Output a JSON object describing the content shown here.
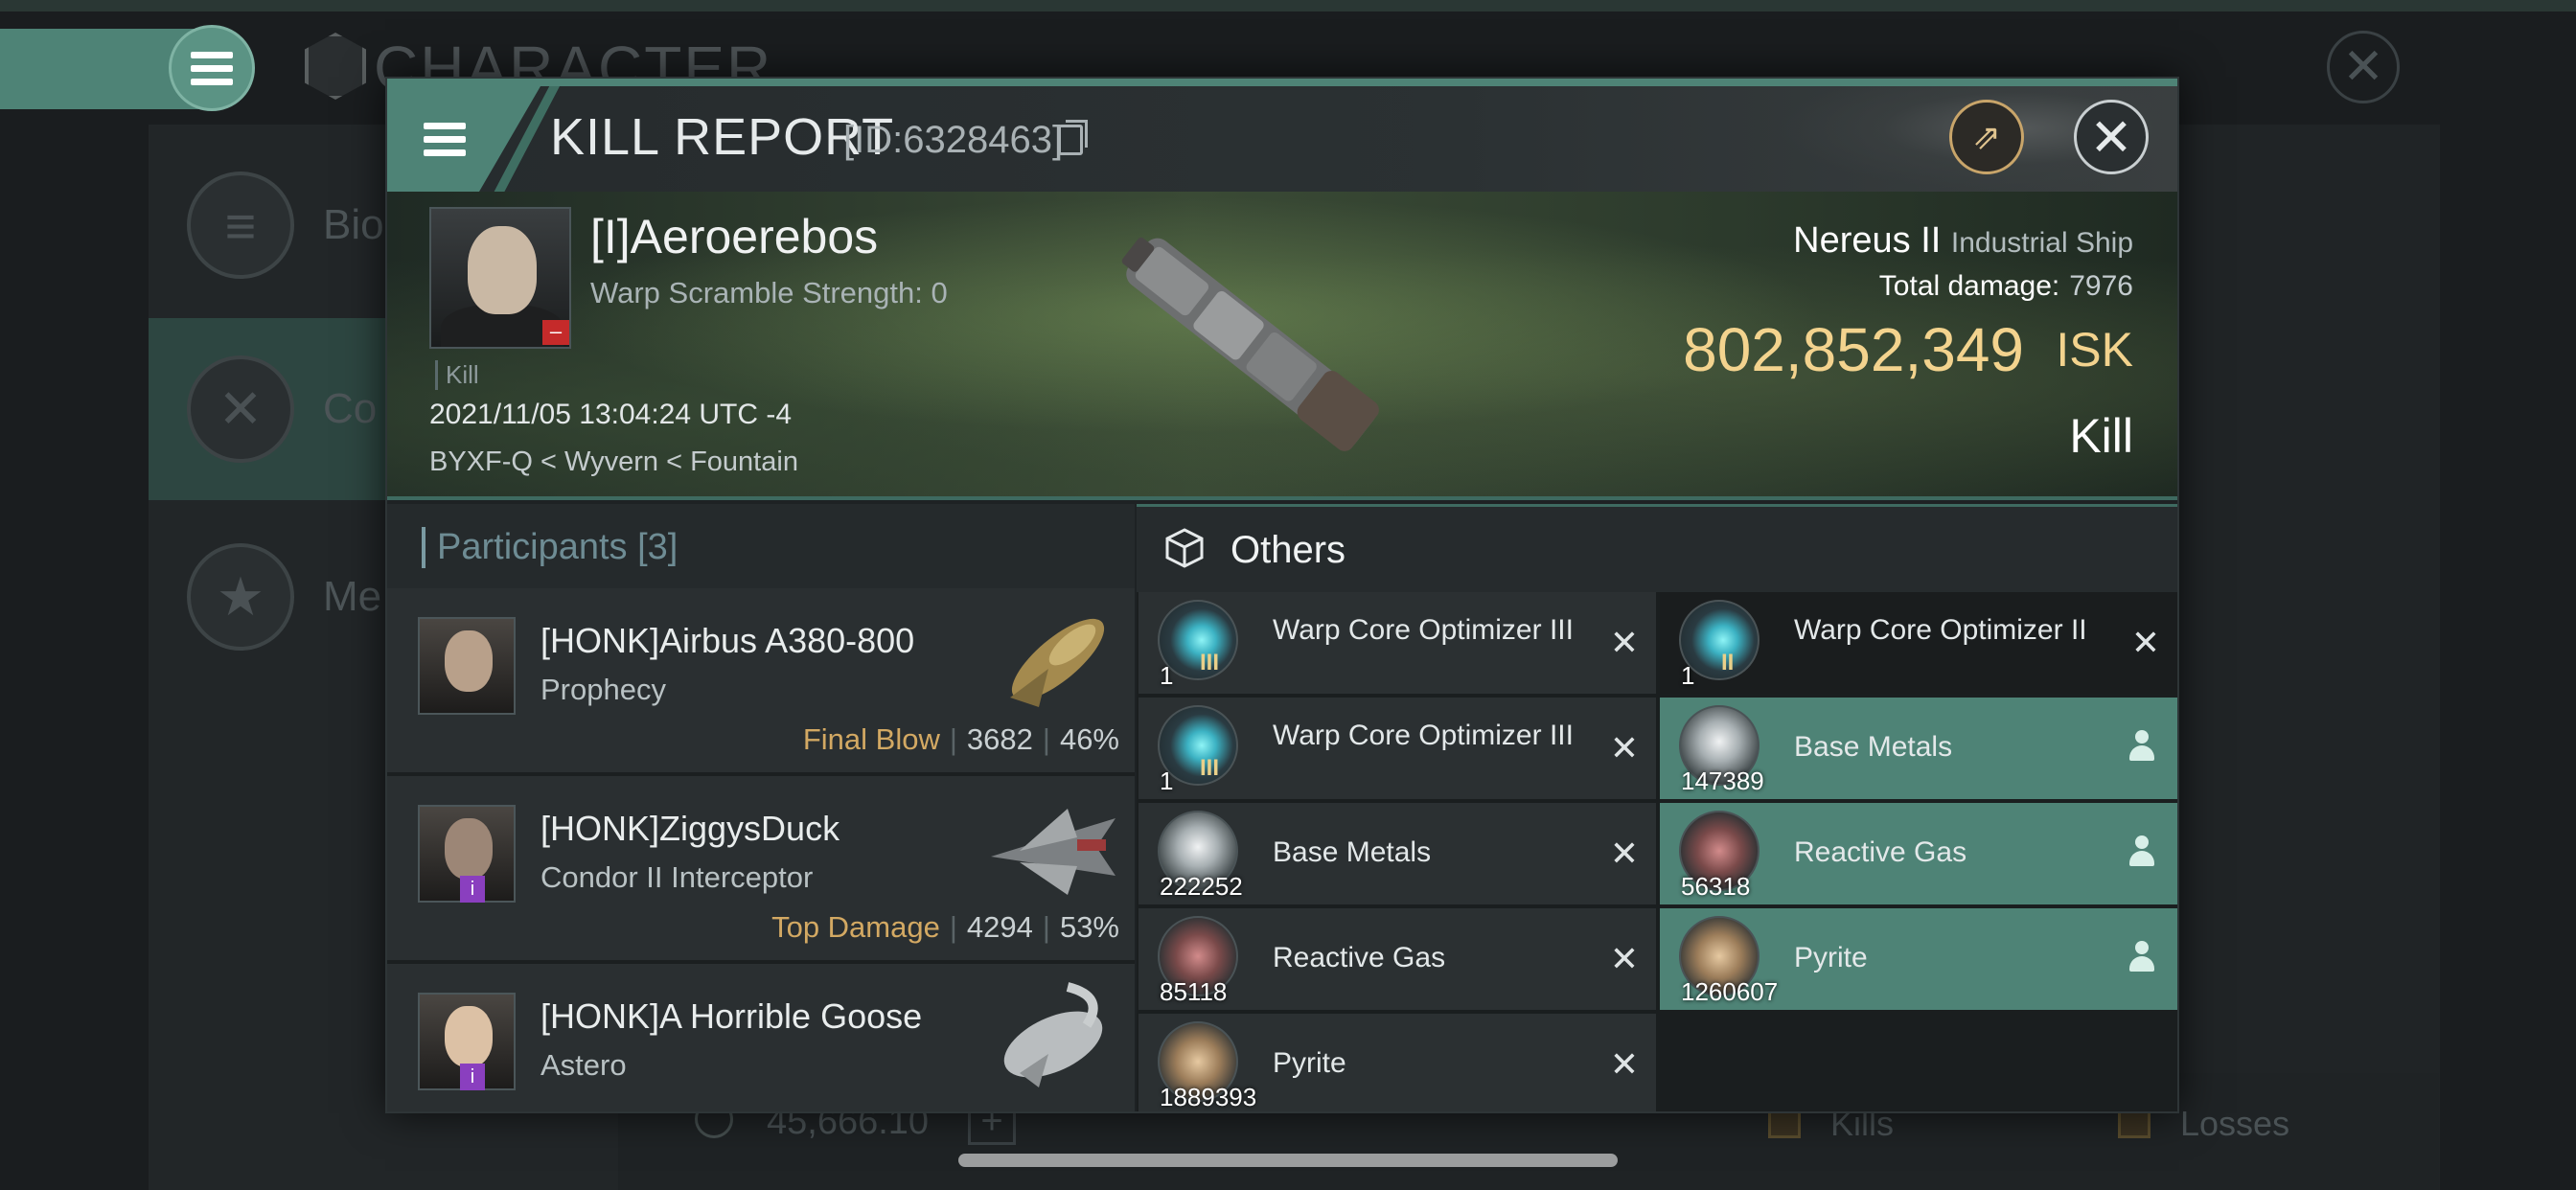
{
  "background": {
    "title": "CHARACTER",
    "side_items": [
      {
        "label": "Bio",
        "icon": "list-icon"
      },
      {
        "label": "Co",
        "icon": "crossed-swords-icon"
      },
      {
        "label": "Me",
        "icon": "star-medal-icon"
      }
    ],
    "isk_balance": "45,666.10",
    "kills_label": "Kills",
    "losses_label": "Losses"
  },
  "window": {
    "title": "KILL REPORT",
    "id_label": "[ID:6328463]"
  },
  "victim": {
    "name": "[I]Aeroerebos",
    "warp_scramble": "Warp Scramble Strength: 0",
    "kill_tag": "Kill",
    "datetime": "2021/11/05 13:04:24 UTC -4",
    "location": "BYXF-Q < Wyvern < Fountain",
    "ship_name": "Nereus II",
    "ship_class": "Industrial Ship",
    "total_damage_label": "Total damage:",
    "total_damage": "7976",
    "isk_value": "802,852,349",
    "isk_unit": "ISK",
    "status": "Kill"
  },
  "participants": {
    "title": "Participants",
    "count": "[3]",
    "list": [
      {
        "name": "[HONK]Airbus A380-800",
        "ship": "Prophecy",
        "tag": "Final Blow",
        "damage": "3682",
        "percent": "46%"
      },
      {
        "name": "[HONK]ZiggysDuck",
        "ship": "Condor II Interceptor",
        "tag": "Top Damage",
        "damage": "4294",
        "percent": "53%"
      },
      {
        "name": "[HONK]A Horrible Goose",
        "ship": "Astero",
        "tag": "",
        "damage": "",
        "percent": ""
      }
    ]
  },
  "items": {
    "title": "Others",
    "list": [
      {
        "name": "Warp Core Optimizer III",
        "qty": "1",
        "tier": "III",
        "icon": "optimizer",
        "state": "destroyed"
      },
      {
        "name": "Warp Core Optimizer II",
        "qty": "1",
        "tier": "II",
        "icon": "optimizer",
        "state": "destroyed"
      },
      {
        "name": "Warp Core Optimizer III",
        "qty": "1",
        "tier": "III",
        "icon": "optimizer",
        "state": "destroyed"
      },
      {
        "name": "Base Metals",
        "qty": "147389",
        "tier": "",
        "icon": "metals",
        "state": "looted"
      },
      {
        "name": "Base Metals",
        "qty": "222252",
        "tier": "",
        "icon": "metals",
        "state": "destroyed"
      },
      {
        "name": "Reactive Gas",
        "qty": "56318",
        "tier": "",
        "icon": "gas",
        "state": "looted"
      },
      {
        "name": "Reactive Gas",
        "qty": "85118",
        "tier": "",
        "icon": "gas",
        "state": "destroyed"
      },
      {
        "name": "Pyrite",
        "qty": "1260607",
        "tier": "",
        "icon": "pyrite",
        "state": "looted"
      },
      {
        "name": "Pyrite",
        "qty": "1889393",
        "tier": "",
        "icon": "pyrite",
        "state": "destroyed"
      }
    ]
  },
  "colors": {
    "accent": "#4e8376",
    "isk_gold": "#f3d38e",
    "final_blow": "#d3a963"
  }
}
